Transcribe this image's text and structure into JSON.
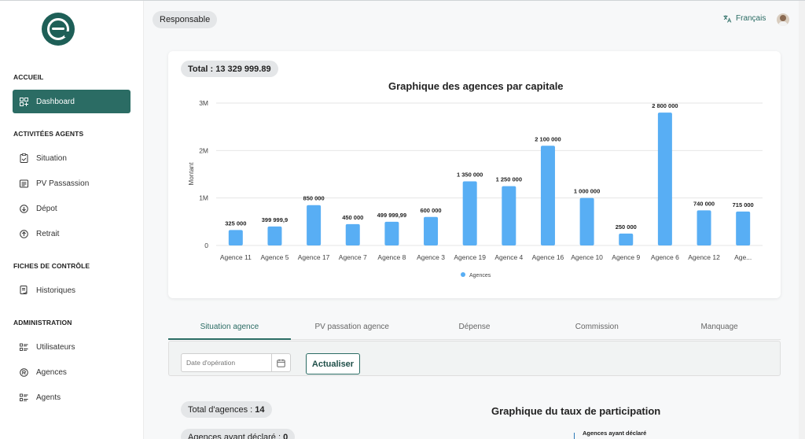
{
  "sidebar": {
    "sections": [
      {
        "title": "ACCUEIL"
      },
      {
        "title": "ACTIVITÉES AGENTS"
      },
      {
        "title": "FICHES DE CONTRÔLE"
      },
      {
        "title": "ADMINISTRATION"
      }
    ],
    "items": [
      {
        "label": "Dashboard",
        "icon": "dashboard-icon"
      },
      {
        "label": "Situation",
        "icon": "clipboard-icon"
      },
      {
        "label": "PV Passassion",
        "icon": "document-icon"
      },
      {
        "label": "Dépot",
        "icon": "arrow-down-circle-icon"
      },
      {
        "label": "Retrait",
        "icon": "arrow-up-circle-icon"
      },
      {
        "label": "Historiques",
        "icon": "history-icon"
      },
      {
        "label": "Utilisateurs",
        "icon": "list-icon"
      },
      {
        "label": "Agences",
        "icon": "agency-icon"
      },
      {
        "label": "Agents",
        "icon": "list-icon"
      }
    ]
  },
  "topbar": {
    "role": "Responsable",
    "language": "Français",
    "language_icon": "translate-icon"
  },
  "total_badge": "Total : 13 329 999.89",
  "chart_data": {
    "type": "bar",
    "title": "Graphique des agences par capitale",
    "ylabel": "Montant",
    "xlabel": "",
    "ylim": [
      0,
      3000000
    ],
    "yticks": [
      "0",
      "1M",
      "2M",
      "3M"
    ],
    "categories": [
      "Agence 11",
      "Agence 5",
      "Agence 17",
      "Agence 7",
      "Agence 8",
      "Agence 3",
      "Agence 19",
      "Agence 4",
      "Agence 16",
      "Agence 10",
      "Agence 9",
      "Agence 6",
      "Agence 12",
      "Age..."
    ],
    "series": [
      {
        "name": "Agences",
        "values": [
          325000,
          399999.9,
          850000,
          450000,
          499999.99,
          600000,
          1350000,
          1250000,
          2100000,
          1000000,
          250000,
          2800000,
          740000,
          715000
        ]
      }
    ],
    "data_labels": [
      "325 000",
      "399 999,9",
      "850 000",
      "450 000",
      "499 999,99",
      "600 000",
      "1 350 000",
      "1 250 000",
      "2 100 000",
      "1 000 000",
      "250 000",
      "2 800 000",
      "740 000",
      "715 000"
    ],
    "bar_color": "#58aef4",
    "legend_position": "bottom",
    "grid": true
  },
  "tabs": [
    {
      "label": "Situation agence",
      "active": true
    },
    {
      "label": "PV passation agence",
      "active": false
    },
    {
      "label": "Dépense",
      "active": false
    },
    {
      "label": "Commission",
      "active": false
    },
    {
      "label": "Manquage",
      "active": false
    }
  ],
  "filter": {
    "date_placeholder": "Date d'opération",
    "refresh_label": "Actualiser"
  },
  "stats": {
    "total_label": "Total d'agences :",
    "total_value": "14",
    "declared_label": "Agences ayant déclaré :",
    "declared_value": "0"
  },
  "participation": {
    "title": "Graphique du taux de participation",
    "legend_item": "Agences ayant déclaré"
  },
  "colors": {
    "accent": "#2b6c64",
    "bar": "#58aef4"
  }
}
